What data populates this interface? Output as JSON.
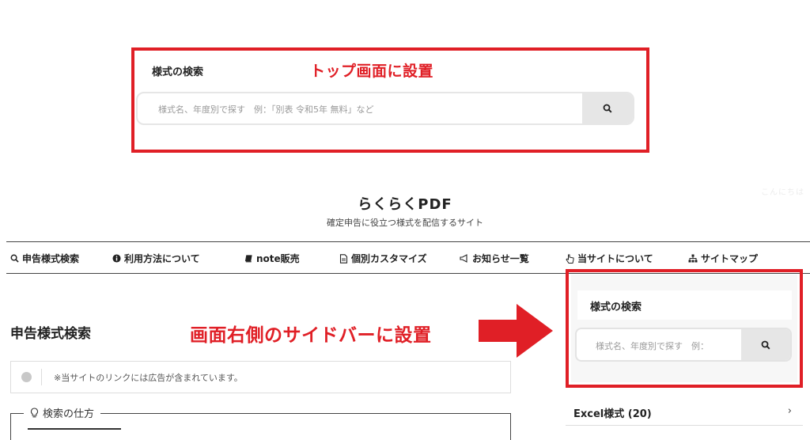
{
  "top_callout": {
    "title": "様式の検索",
    "annotation": "トップ画面に設置",
    "search_placeholder": "様式名、年度別で探す　例：「別表 令和5年 無料」など"
  },
  "watermark": "こんにちは",
  "site": {
    "title": "らくらくPDF",
    "tagline": "確定申告に役立つ様式を配信するサイト"
  },
  "nav": {
    "items": [
      {
        "label": "申告様式検索",
        "icon": "search-icon"
      },
      {
        "label": "利用方法について",
        "icon": "info-icon"
      },
      {
        "label": "note販売",
        "icon": "book-icon"
      },
      {
        "label": "個別カスタマイズ",
        "icon": "file-icon"
      },
      {
        "label": "お知らせ一覧",
        "icon": "megaphone-icon"
      },
      {
        "label": "当サイトについて",
        "icon": "pointer-icon"
      },
      {
        "label": "サイトマップ",
        "icon": "sitemap-icon"
      }
    ]
  },
  "main": {
    "heading": "申告様式検索",
    "notice": "※当サイトのリンクには広告が含まれています。",
    "howto_label": "検索の仕方"
  },
  "annotation_side": "画面右側のサイドバーに設置",
  "sidebar": {
    "title": "様式の検索",
    "search_placeholder": "様式名、年度別で探す　例：",
    "category": {
      "label": "Excel様式 (20)",
      "chevron": "›"
    }
  },
  "colors": {
    "accent_red": "#e01f26",
    "button_gray": "#e6e6e6"
  }
}
